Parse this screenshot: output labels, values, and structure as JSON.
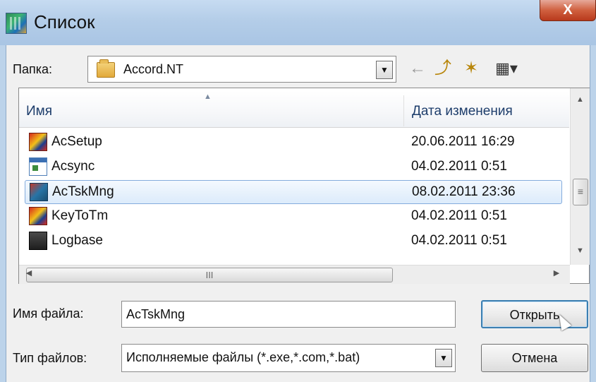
{
  "window": {
    "title": "Список",
    "close_label": "X"
  },
  "folder": {
    "label": "Папка:",
    "value": "Accord.NT"
  },
  "toolbar": {
    "back_icon": "←",
    "up_icon": "⤴",
    "new_folder_icon": "✶",
    "view_icon": "▦▾"
  },
  "list": {
    "headers": {
      "name": "Имя",
      "date": "Дата изменения"
    },
    "rows": [
      {
        "name": "AcSetup",
        "date": "20.06.2011 16:29",
        "icon": "installer-icon"
      },
      {
        "name": "Acsync",
        "date": "04.02.2011 0:51",
        "icon": "window-app-icon"
      },
      {
        "name": "AcTskMng",
        "date": "08.02.2011 23:36",
        "icon": "task-manager-icon",
        "selected": true
      },
      {
        "name": "KeyToTm",
        "date": "04.02.2011 0:51",
        "icon": "installer-icon"
      },
      {
        "name": "Logbase",
        "date": "04.02.2011 0:51",
        "icon": "log-database-icon"
      }
    ],
    "scroll_grip": "≡",
    "hscroll_grip": "III"
  },
  "form": {
    "filename_label": "Имя файла:",
    "filename_value": "AcTskMng",
    "filetype_label": "Тип файлов:",
    "filetype_value": "Исполняемые файлы (*.exe,*.com,*.bat)"
  },
  "buttons": {
    "open": "Открыть",
    "cancel": "Отмена"
  },
  "colors": {
    "selection_border": "#84acdd",
    "titlebar": "#b4cde8",
    "close_button": "#d0603f"
  }
}
